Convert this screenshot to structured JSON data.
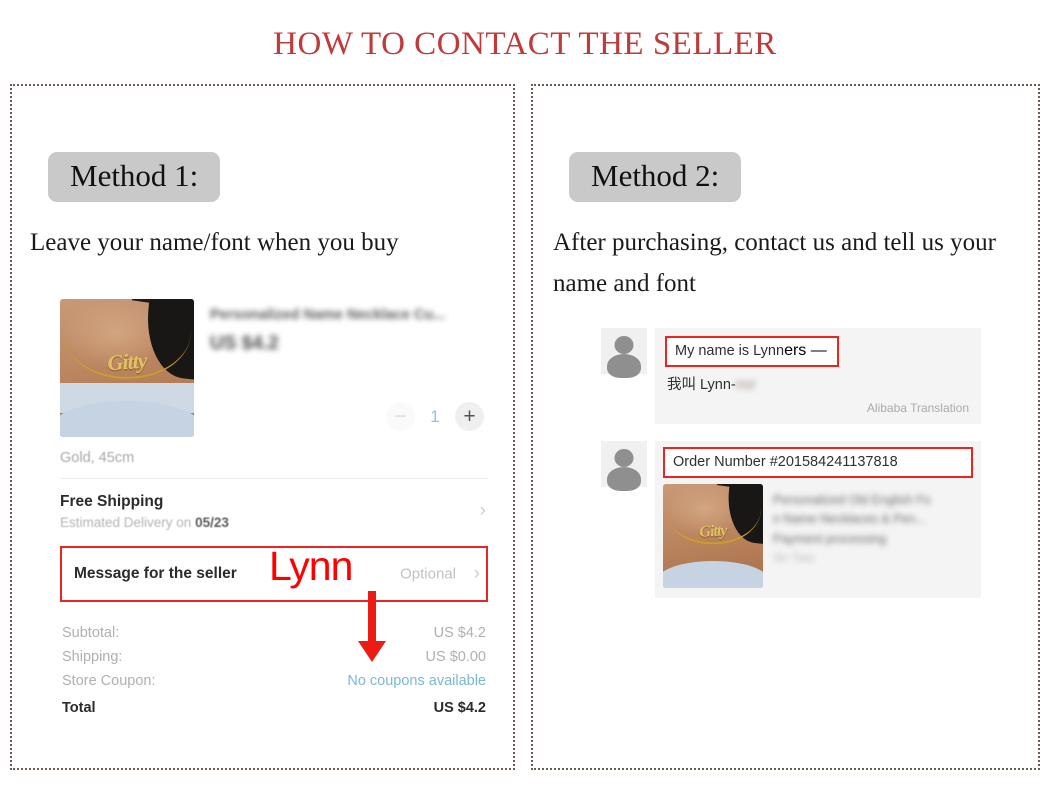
{
  "page": {
    "title": "HOW TO CONTACT THE SELLER",
    "title_color": "#C03A3A"
  },
  "method1": {
    "badge": "Method 1:",
    "description": "Leave your name/font when you buy",
    "annotation": {
      "name_label": "Lynn",
      "arrow": "down-arrow",
      "color": "#EC1C15"
    },
    "cart": {
      "product_title_blurred": "Personalized Name Necklace Cu...",
      "product_price_blurred": "US $4.2",
      "product_photo_name": "Gitty",
      "quantity": {
        "minus": "−",
        "value": "1",
        "plus": "+"
      },
      "variant": "Gold, 45cm",
      "shipping": {
        "title": "Free Shipping",
        "subtitle_prefix": "Estimated Delivery on ",
        "subtitle_date": "05/23",
        "chevron": "›"
      },
      "message_row": {
        "label": "Message for the seller",
        "value": "Optional",
        "chevron": "›"
      },
      "totals": [
        {
          "label": "Subtotal:",
          "value": "US $4.2"
        },
        {
          "label": "Shipping:",
          "value": "US $0.00"
        },
        {
          "label": "Store Coupon:",
          "value": "No coupons available"
        },
        {
          "label": "Total",
          "value": "US $4.2"
        }
      ],
      "coupon_link_color": "#7BB8D4"
    }
  },
  "method2": {
    "badge": "Method 2:",
    "description": "After purchasing, contact us and tell us your name and font",
    "chat": {
      "message1": {
        "english": "My name is Lynn",
        "english_redacted": "ers —",
        "chinese": "我叫  Lynn-",
        "chinese_redacted": "nsr",
        "translation_note": "Alibaba Translation"
      },
      "message2": {
        "order_number": "Order Number #201584241137818",
        "product_photo_name": "Gitty",
        "blurred_lines": [
          "Personalized Old English Fo",
          "n Name Necklaces & Pen...",
          "Payment processing",
          "Sn Two"
        ]
      }
    }
  }
}
